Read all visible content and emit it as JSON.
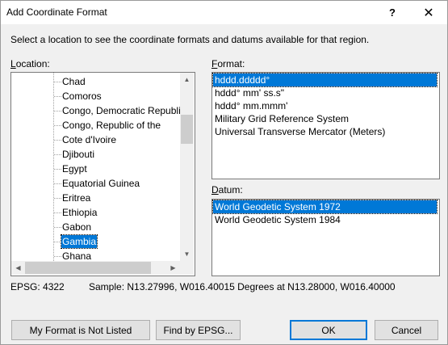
{
  "window": {
    "title": "Add Coordinate Format",
    "help_label": "?",
    "close_label": "✕"
  },
  "instructions": "Select a location to see the coordinate formats and datums available for that region.",
  "location": {
    "label_accel": "L",
    "label_rest": "ocation:",
    "items": [
      {
        "label": "Chad",
        "selected": false
      },
      {
        "label": "Comoros",
        "selected": false
      },
      {
        "label": "Congo, Democratic Republi",
        "selected": false
      },
      {
        "label": "Congo, Republic of the",
        "selected": false
      },
      {
        "label": "Cote d'Ivoire",
        "selected": false
      },
      {
        "label": "Djibouti",
        "selected": false
      },
      {
        "label": "Egypt",
        "selected": false
      },
      {
        "label": "Equatorial Guinea",
        "selected": false
      },
      {
        "label": "Eritrea",
        "selected": false
      },
      {
        "label": "Ethiopia",
        "selected": false
      },
      {
        "label": "Gabon",
        "selected": false
      },
      {
        "label": "Gambia",
        "selected": true
      },
      {
        "label": "Ghana",
        "selected": false
      }
    ]
  },
  "format": {
    "label_accel": "F",
    "label_rest": "ormat:",
    "items": [
      {
        "label": "hddd.ddddd°",
        "selected": true
      },
      {
        "label": "hddd° mm' ss.s\"",
        "selected": false
      },
      {
        "label": "hddd° mm.mmm'",
        "selected": false
      },
      {
        "label": "Military Grid Reference System",
        "selected": false
      },
      {
        "label": "Universal Transverse Mercator (Meters)",
        "selected": false
      }
    ]
  },
  "datum": {
    "label_accel": "D",
    "label_rest": "atum:",
    "items": [
      {
        "label": "World Geodetic System 1972",
        "selected": true
      },
      {
        "label": "World Geodetic System 1984",
        "selected": false
      }
    ]
  },
  "status": {
    "epsg": "EPSG: 4322",
    "sample": "Sample: N13.27996, W016.40015 Degrees at N13.28000, W016.40000"
  },
  "buttons": {
    "not_listed": "My Format is Not Listed",
    "find_epsg": "Find by EPSG...",
    "ok": "OK",
    "cancel": "Cancel"
  }
}
